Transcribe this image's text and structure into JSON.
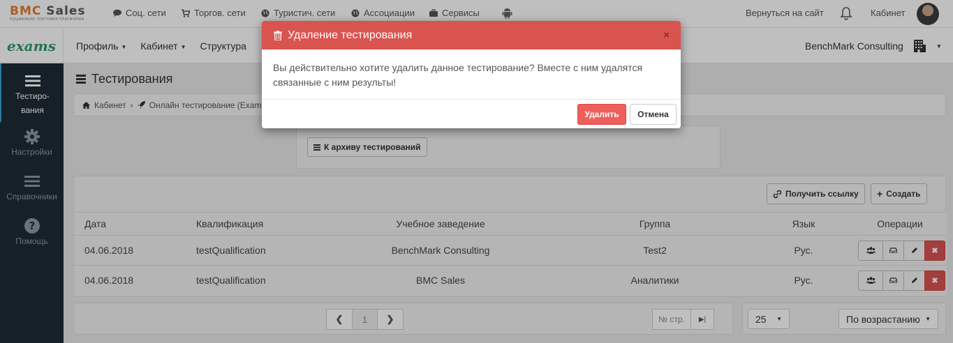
{
  "topbar": {
    "logo_main_a": "BMC",
    "logo_main_b": " Sales",
    "logo_sub": "СОЦИАЛЬНО ТОРГОВАЯ ПЛАТФОРМА",
    "links": [
      "Соц. сети",
      "Торгов. сети",
      "Туристич. сети",
      "Ассоциации",
      "Сервисы"
    ],
    "back_to_site": "Вернуться на сайт",
    "cabinet": "Кабинет"
  },
  "navbar": {
    "brand": "exams",
    "menu": [
      "Профиль",
      "Кабинет",
      "Структура"
    ],
    "company": "BenchMark Consulting"
  },
  "sidebar": {
    "items": [
      {
        "label_1": "Тестиро-",
        "label_2": "вания"
      },
      {
        "label": "Настройки"
      },
      {
        "label": "Справочники"
      },
      {
        "label": "Помощь"
      }
    ]
  },
  "page": {
    "title": "Тестирования",
    "breadcrumb": [
      "Кабинет",
      "Онлайн тестирование (Exams)"
    ],
    "archive_button": "К архиву тестирований",
    "get_link_button": "Получить ссылку",
    "create_button": "Создать"
  },
  "table": {
    "headers": [
      "Дата",
      "Квалификация",
      "Учебное заведение",
      "Группа",
      "Язык",
      "Операции"
    ],
    "rows": [
      [
        "04.06.2018",
        "testQualification",
        "BenchMark Consulting",
        "Test2",
        "Рус."
      ],
      [
        "04.06.2018",
        "testQualification",
        "BMC Sales",
        "Аналитики",
        "Рус."
      ]
    ]
  },
  "pagination": {
    "current": "1",
    "page_placeholder": "№ стр."
  },
  "sort": {
    "page_size": "25",
    "order": "По возрастанию"
  },
  "modal": {
    "title": "Удаление тестирования",
    "close": "×",
    "body": "Вы действительно хотите удалить данное тестирование? Вместе с ним удалятся связанные с ним результы!",
    "confirm": "Удалить",
    "cancel": "Отмена"
  },
  "colors": {
    "modal_header": "#d9534f",
    "sidebar_bg": "#1c2b36",
    "brand_green": "#2e9c6a",
    "danger_button": "#ee5f5b"
  }
}
